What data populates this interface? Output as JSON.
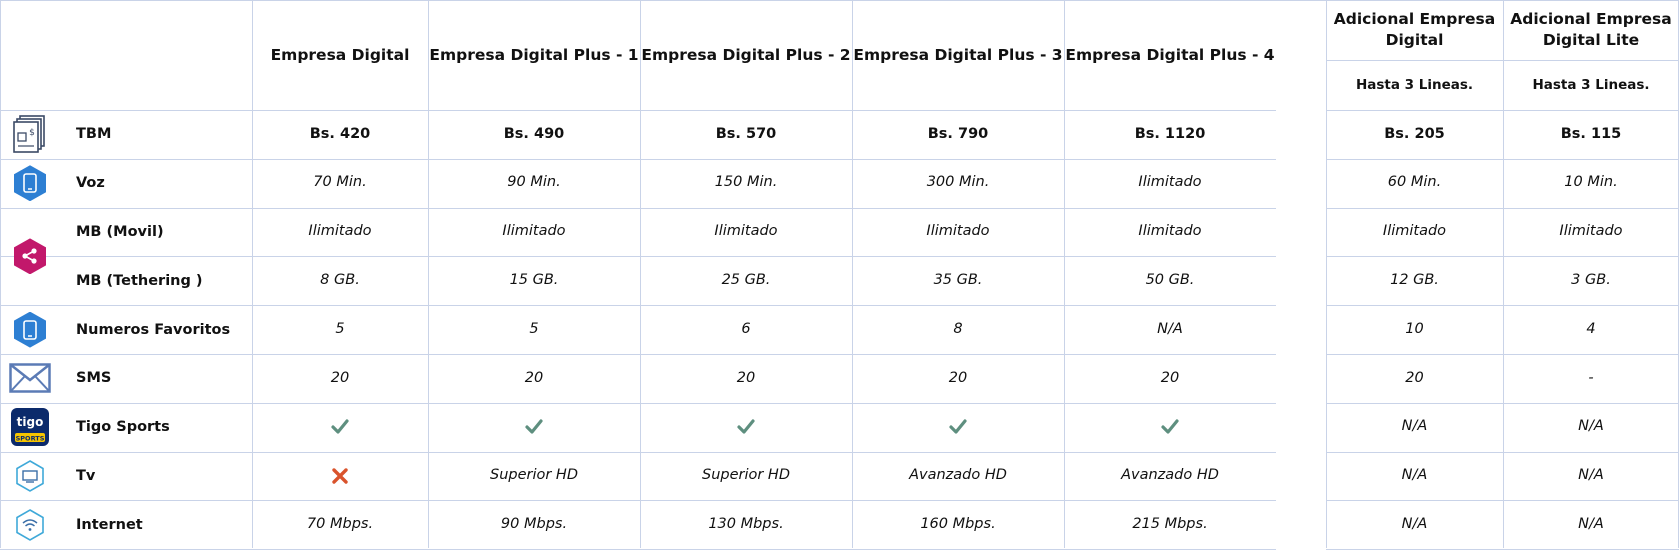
{
  "columns": [
    "Empresa Digital",
    "Empresa Digital Plus - 1",
    "Empresa Digital Plus - 2",
    "Empresa Digital Plus - 3",
    "Empresa Digital Plus - 4"
  ],
  "additional": [
    {
      "title": "Adicional Empresa Digital",
      "subtitle": "Hasta 3 Lineas."
    },
    {
      "title": "Adicional Empresa Digital Lite",
      "subtitle": "Hasta 3 Lineas."
    }
  ],
  "rows": [
    {
      "label": "TBM",
      "icon": "bill-icon",
      "values": [
        "Bs. 420",
        "Bs. 490",
        "Bs. 570",
        "Bs. 790",
        "Bs. 1120",
        "Bs. 205",
        "Bs. 115"
      ]
    },
    {
      "label": "Voz",
      "icon": "phone-icon",
      "values": [
        "70 Min.",
        "90 Min.",
        "150 Min.",
        "300 Min.",
        "Ilimitado",
        "60 Min.",
        "10 Min."
      ]
    },
    {
      "label": "MB (Movil)",
      "icon": "share-icon",
      "values": [
        "Ilimitado",
        "Ilimitado",
        "Ilimitado",
        "Ilimitado",
        "Ilimitado",
        "Ilimitado",
        "Ilimitado"
      ]
    },
    {
      "label": "MB (Tethering )",
      "icon": "share-icon",
      "values": [
        "8 GB.",
        "15 GB.",
        "25 GB.",
        "35 GB.",
        "50 GB.",
        "12 GB.",
        "3 GB."
      ]
    },
    {
      "label": "Numeros Favoritos",
      "icon": "phone-icon",
      "values": [
        "5",
        "5",
        "6",
        "8",
        "N/A",
        "10",
        "4"
      ]
    },
    {
      "label": "SMS",
      "icon": "envelope-icon",
      "values": [
        "20",
        "20",
        "20",
        "20",
        "20",
        "20",
        "-"
      ]
    },
    {
      "label": "Tigo Sports",
      "icon": "tigo-sports-logo",
      "values": [
        "check",
        "check",
        "check",
        "check",
        "check",
        "N/A",
        "N/A"
      ]
    },
    {
      "label": "Tv",
      "icon": "tv-icon",
      "values": [
        "cross",
        "Superior HD",
        "Superior HD",
        "Avanzado HD",
        "Avanzado HD",
        "N/A",
        "N/A"
      ]
    },
    {
      "label": "Internet",
      "icon": "wifi-icon",
      "values": [
        "70 Mbps.",
        "90 Mbps.",
        "130 Mbps.",
        "160 Mbps.",
        "215 Mbps.",
        "N/A",
        "N/A"
      ]
    }
  ],
  "logo_text": {
    "top": "tigo",
    "bottom": "SPORTS"
  },
  "colors": {
    "grid": "#c9d3e8",
    "blue": "#2d7fd3",
    "magenta": "#c2186b",
    "check": "#5e8f7f",
    "cross": "#d9532c",
    "navy": "#0b2a6b",
    "gold": "#f5c400"
  }
}
